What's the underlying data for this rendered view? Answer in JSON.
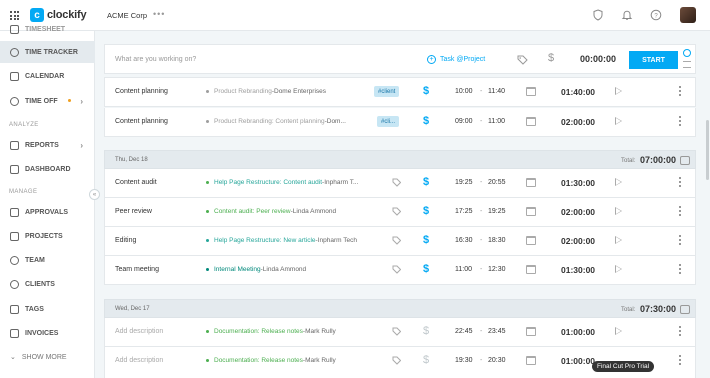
{
  "header": {
    "logo_text": "clockify",
    "logo_mark": "c",
    "workspace": "ACME Corp",
    "more": "•••",
    "icons": [
      "apps-grid-icon",
      "shield-check-icon",
      "bell-icon",
      "help-icon",
      "user-avatar"
    ]
  },
  "sidebar": {
    "items": [
      {
        "label": "TIME TRACKER",
        "icon": "clock-icon",
        "active": true
      },
      {
        "label": "CALENDAR",
        "icon": "calendar-icon"
      },
      {
        "label": "TIME OFF",
        "icon": "time-off-icon"
      },
      {
        "label": "REPORTS",
        "icon": "chart-icon"
      },
      {
        "label": "DASHBOARD",
        "icon": "dashboard-icon"
      },
      {
        "label": "APPROVALS",
        "icon": "approvals-icon"
      },
      {
        "label": "PROJECTS",
        "icon": "projects-icon"
      },
      {
        "label": "TEAM",
        "icon": "team-icon"
      },
      {
        "label": "CLIENTS",
        "icon": "clients-icon"
      },
      {
        "label": "TAGS",
        "icon": "tag-icon"
      },
      {
        "label": "INVOICES",
        "icon": "invoice-icon"
      },
      {
        "label": "SHOW MORE",
        "icon": "chevron-down-icon"
      }
    ],
    "sections": {
      "analyze": "ANALYZE",
      "manage": "MANAGE"
    },
    "partial_top": "TIMESHEET"
  },
  "tracker": {
    "placeholder": "What are you working on?",
    "project_label": "Task @Project",
    "timer": "00:00:00",
    "start_label": "START"
  },
  "groups": [
    {
      "date": "",
      "total_label": "",
      "total": "",
      "entries": [
        {
          "description": "Content planning",
          "project": "Product Rebranding",
          "client": "Dome Enterprises",
          "color": "#9e9e9e",
          "tag": "#client",
          "billable": true,
          "start": "10:00",
          "end": "11:40",
          "duration": "01:40:00"
        },
        {
          "description": "Content planning",
          "project": "Product Rebranding: Content planning",
          "client": "Dom...",
          "color": "#9e9e9e",
          "tag": "#cli...",
          "billable": true,
          "start": "09:00",
          "end": "11:00",
          "duration": "02:00:00"
        }
      ]
    },
    {
      "date": "Thu, Dec 18",
      "total_label": "Total:",
      "total": "07:00:00",
      "entries": [
        {
          "description": "Content audit",
          "project": "Help Page Restructure: Content audit",
          "client": "Inpharm T...",
          "color": "#4caf50",
          "project_color": "#26a69a",
          "tag": "",
          "billable": true,
          "start": "19:25",
          "end": "20:55",
          "duration": "01:30:00"
        },
        {
          "description": "Peer review",
          "project": "Content audit: Peer review",
          "client": "Linda Ammond",
          "color": "#4caf50",
          "project_color": "#4caf50",
          "tag": "",
          "billable": true,
          "start": "17:25",
          "end": "19:25",
          "duration": "02:00:00"
        },
        {
          "description": "Editing",
          "project": "Help Page Restructure: New article",
          "client": "Inpharm Tech",
          "color": "#26a69a",
          "project_color": "#26a69a",
          "tag": "",
          "billable": true,
          "start": "16:30",
          "end": "18:30",
          "duration": "02:00:00"
        },
        {
          "description": "Team meeting",
          "project": "Internal Meeting",
          "client": "Linda Ammond",
          "color": "#00897b",
          "project_color": "#00897b",
          "tag": "",
          "billable": true,
          "start": "11:00",
          "end": "12:30",
          "duration": "01:30:00"
        }
      ]
    },
    {
      "date": "Wed, Dec 17",
      "total_label": "Total:",
      "total": "07:30:00",
      "entries": [
        {
          "description": "Add description",
          "placeholder": true,
          "project": "Documentation: Release notes",
          "client": "Mark Rully",
          "color": "#4caf50",
          "project_color": "#4caf50",
          "tag": "",
          "billable": false,
          "start": "22:45",
          "end": "23:45",
          "duration": "01:00:00"
        },
        {
          "description": "Add description",
          "placeholder": true,
          "project": "Documentation: Release notes",
          "client": "Mark Rully",
          "color": "#4caf50",
          "project_color": "#4caf50",
          "tag": "",
          "billable": false,
          "start": "19:30",
          "end": "20:30",
          "duration": "01:00:00"
        }
      ]
    }
  ],
  "dash": "-",
  "client_sep": " - ",
  "currency": "$",
  "tooltip": "Final Cut Pro Trial",
  "colors": {
    "accent": "#03a9f4",
    "sidebar_active": "#e4eaee",
    "background": "#f2f6f8"
  }
}
